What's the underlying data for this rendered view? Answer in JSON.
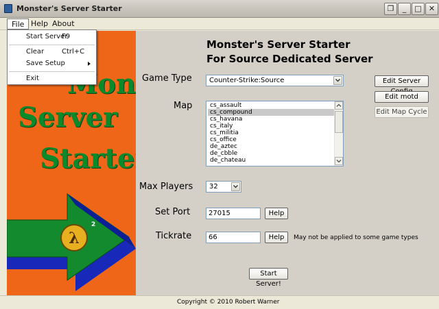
{
  "window": {
    "title": "Monster's Server Starter",
    "controls": {
      "restore": "❐",
      "minimize": "_",
      "maximize": "□",
      "close": "✕"
    }
  },
  "menubar": {
    "items": [
      "File",
      "Help",
      "About"
    ]
  },
  "file_menu": {
    "items": [
      {
        "label": "Start Server",
        "shortcut": "F9"
      },
      {
        "label": "Clear",
        "shortcut": "Ctrl+C"
      },
      {
        "label": "Save Setup",
        "shortcut": ""
      },
      {
        "label": "Exit",
        "shortcut": ""
      }
    ]
  },
  "banner": {
    "words": [
      "Monster's",
      "Server",
      "Starter"
    ],
    "logo_text": "λ",
    "logo_superscript": "2",
    "colors": {
      "background": "#f06619",
      "text": "#0b8a2c",
      "arrow_green": "#138a2e",
      "arrow_blue": "#1828b8"
    }
  },
  "header": {
    "line1": "Monster's Server Starter",
    "line2": "For Source Dedicated Server"
  },
  "game_type": {
    "label": "Game Type",
    "value": "Counter-Strike:Source"
  },
  "map": {
    "label": "Map",
    "items": [
      "cs_assault",
      "cs_compound",
      "cs_havana",
      "cs_italy",
      "cs_militia",
      "cs_office",
      "de_aztec",
      "de_cbble",
      "de_chateau"
    ],
    "selected": "cs_compound"
  },
  "side_buttons": {
    "edit_server_config": "Edit Server Config",
    "edit_motd": "Edit motd",
    "edit_map_cycle": "Edit Map Cycle"
  },
  "max_players": {
    "label": "Max Players",
    "value": "32"
  },
  "set_port": {
    "label": "Set Port",
    "value": "27015",
    "help": "Help"
  },
  "tickrate": {
    "label": "Tickrate",
    "value": "66",
    "help": "Help",
    "note": "May not be applied to some game types"
  },
  "start_button": "Start Server!",
  "status": {
    "copyright": "Copyright © 2010 Robert Warner"
  }
}
